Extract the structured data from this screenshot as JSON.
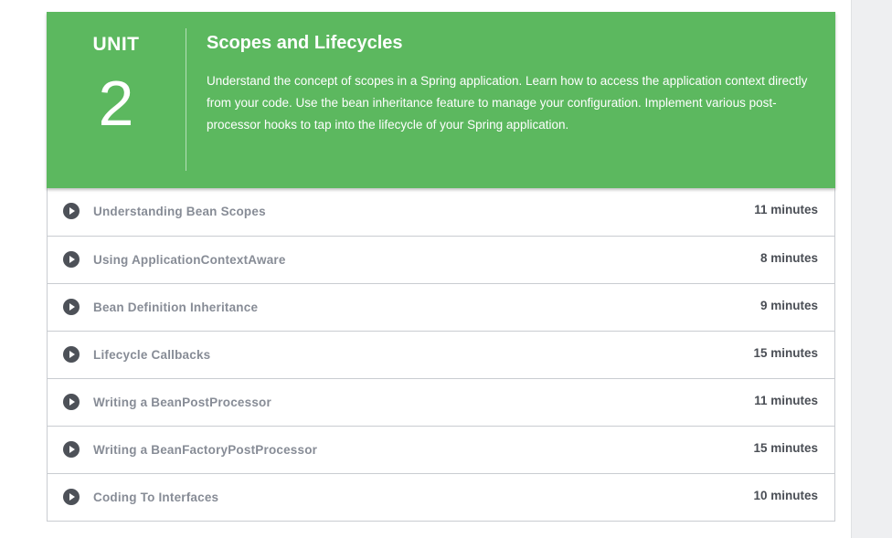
{
  "unit": {
    "label": "UNIT",
    "number": "2",
    "title": "Scopes and Lifecycles",
    "description": "Understand the concept of scopes in a Spring application. Learn how to access the application context directly from your code. Use the bean inheritance feature to manage your configuration. Implement various post-processor hooks to tap into the lifecycle of your Spring application."
  },
  "lessons": [
    {
      "title": "Understanding Bean Scopes",
      "duration": "11 minutes",
      "icon": "play-circle-icon"
    },
    {
      "title": "Using ApplicationContextAware",
      "duration": "8 minutes",
      "icon": "play-circle-icon"
    },
    {
      "title": "Bean Definition Inheritance",
      "duration": "9 minutes",
      "icon": "play-circle-icon"
    },
    {
      "title": "Lifecycle Callbacks",
      "duration": "15 minutes",
      "icon": "play-circle-icon"
    },
    {
      "title": "Writing a BeanPostProcessor",
      "duration": "11 minutes",
      "icon": "play-circle-icon"
    },
    {
      "title": "Writing a BeanFactoryPostProcessor",
      "duration": "15 minutes",
      "icon": "play-circle-icon"
    },
    {
      "title": "Coding To Interfaces",
      "duration": "10 minutes",
      "icon": "play-circle-icon"
    }
  ],
  "colors": {
    "header_green": "#5cb85f",
    "lesson_title": "#878c96",
    "duration_text": "#4a4e55",
    "play_icon": "#4d5158"
  }
}
